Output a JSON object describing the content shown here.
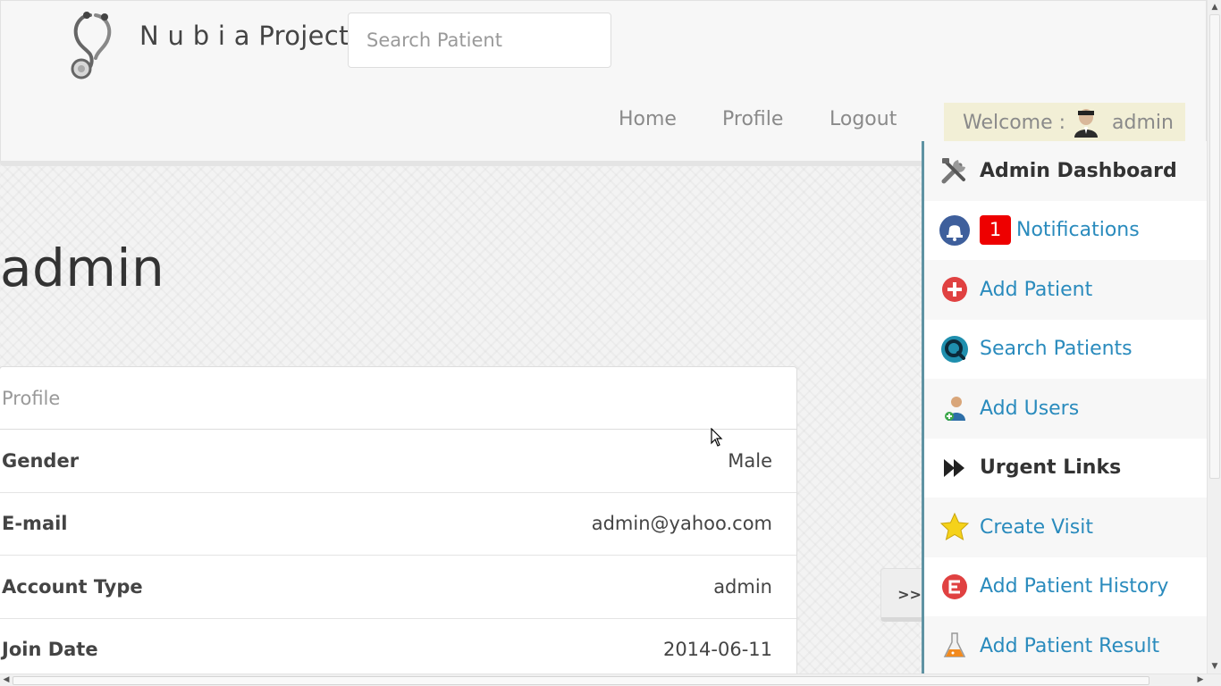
{
  "header": {
    "brand_name": "N u b i a Project",
    "search_placeholder": "Search Patient",
    "nav": [
      {
        "label": "Home"
      },
      {
        "label": "Profile"
      },
      {
        "label": "Logout"
      }
    ],
    "welcome_label": "Welcome :",
    "welcome_user": "admin"
  },
  "main": {
    "title": "admin",
    "panel_heading": "Profile",
    "rows": [
      {
        "label": "Gender",
        "value": "Male"
      },
      {
        "label": "E-mail",
        "value": "admin@yahoo.com"
      },
      {
        "label": "Account Type",
        "value": "admin"
      },
      {
        "label": "Join Date",
        "value": "2014-06-11"
      }
    ]
  },
  "toggle_label": ">>",
  "sidebar": {
    "items": [
      {
        "label": "Admin Dashboard",
        "icon": "tools-icon"
      },
      {
        "label": "Notifications",
        "icon": "bell-icon",
        "badge": "1"
      },
      {
        "label": "Add Patient",
        "icon": "plus-circle-icon"
      },
      {
        "label": "Search Patients",
        "icon": "search-icon"
      },
      {
        "label": "Add Users",
        "icon": "user-add-icon"
      },
      {
        "label": "Urgent Links",
        "icon": "fast-forward-icon"
      },
      {
        "label": "Create Visit",
        "icon": "star-icon"
      },
      {
        "label": "Add Patient History",
        "icon": "history-icon"
      },
      {
        "label": "Add Patient Result",
        "icon": "flask-icon"
      }
    ]
  },
  "colors": {
    "link": "#2a8bbd",
    "sidebar_border": "#5f93a3",
    "badge": "#ee0000",
    "welcome_bg": "#f2efd6"
  }
}
